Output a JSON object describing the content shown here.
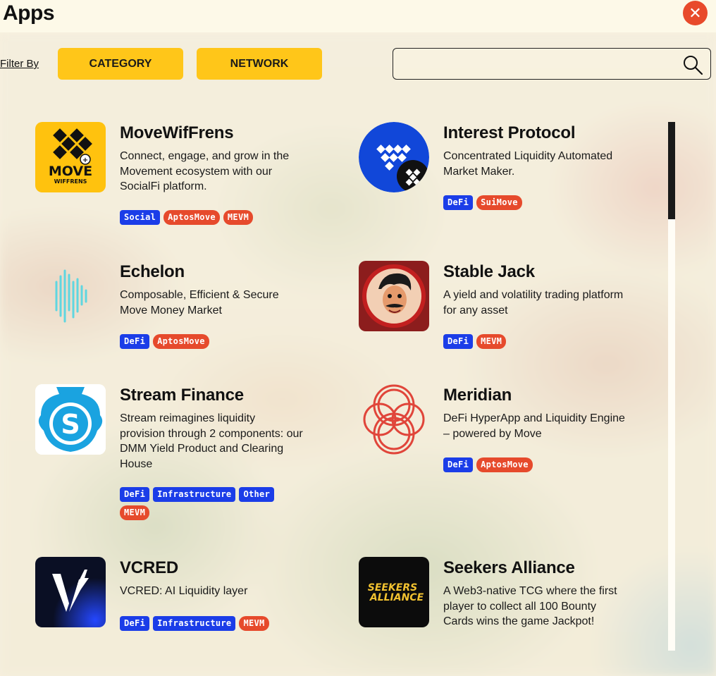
{
  "header": {
    "title": "Apps",
    "close_label": "✕"
  },
  "filters": {
    "label": "Filter By",
    "category_label": "CATEGORY",
    "network_label": "NETWORK"
  },
  "search": {
    "placeholder": "",
    "value": ""
  },
  "colors": {
    "accent_yellow": "#ffc619",
    "close_red": "#e84a2b",
    "category_tag": "#1b3de8",
    "network_tag": "#e64a2c"
  },
  "apps": [
    {
      "name": "MoveWifFrens",
      "description": "Connect, engage, and grow in the Movement ecosystem with our SocialFi platform.",
      "categories": [
        "Social"
      ],
      "networks": [
        "AptosMove",
        "MEVM"
      ],
      "logo_text_1": "MOVE",
      "logo_text_2": "WIFFRENS"
    },
    {
      "name": "Interest Protocol",
      "description": "Concentrated Liquidity Automated Market Maker.",
      "categories": [
        "DeFi"
      ],
      "networks": [
        "SuiMove"
      ]
    },
    {
      "name": "Echelon",
      "description": "Composable, Efficient & Secure Move Money Market",
      "categories": [
        "DeFi"
      ],
      "networks": [
        "AptosMove"
      ]
    },
    {
      "name": "Stable Jack",
      "description": "A yield and volatility trading platform for any asset",
      "categories": [
        "DeFi"
      ],
      "networks": [
        "MEVM"
      ]
    },
    {
      "name": "Stream Finance",
      "description": "Stream reimagines liquidity provision through 2 components: our DMM Yield Product and Clearing House",
      "categories": [
        "DeFi",
        "Infrastructure",
        "Other"
      ],
      "networks": [
        "MEVM"
      ],
      "logo_text_1": "S"
    },
    {
      "name": "Meridian",
      "description": "DeFi HyperApp and Liquidity Engine – powered by Move",
      "categories": [
        "DeFi"
      ],
      "networks": [
        "AptosMove"
      ]
    },
    {
      "name": "VCRED",
      "description": "VCRED: AI Liquidity layer",
      "categories": [
        "DeFi",
        "Infrastructure"
      ],
      "networks": [
        "MEVM"
      ]
    },
    {
      "name": "Seekers Alliance",
      "description": "A Web3-native TCG where the first player to collect all 100 Bounty Cards wins the game Jackpot!",
      "categories": [],
      "networks": [],
      "logo_text_1": "SEEKERS",
      "logo_text_2": "ALLIANCE"
    }
  ]
}
